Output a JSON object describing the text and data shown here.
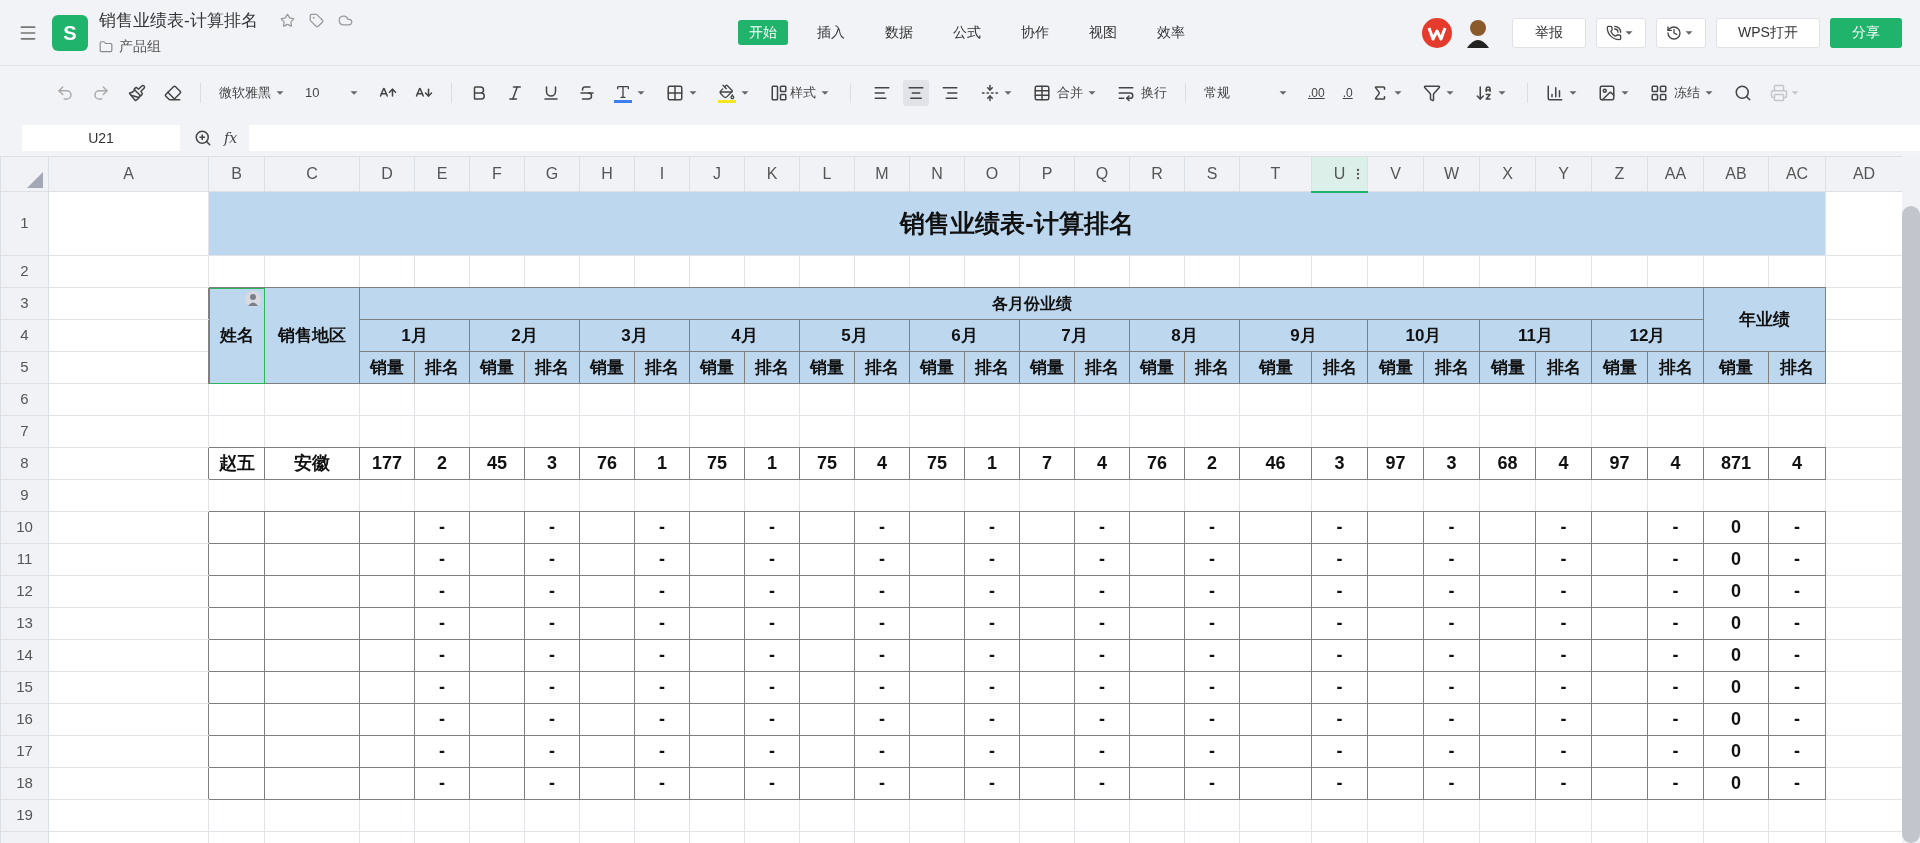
{
  "document": {
    "app_letter": "S",
    "title": "销售业绩表-计算排名",
    "folder": "产品组"
  },
  "menu_tabs": [
    {
      "label": "开始",
      "selected": true
    },
    {
      "label": "插入",
      "selected": false
    },
    {
      "label": "数据",
      "selected": false
    },
    {
      "label": "公式",
      "selected": false
    },
    {
      "label": "协作",
      "selected": false
    },
    {
      "label": "视图",
      "selected": false
    },
    {
      "label": "效率",
      "selected": false
    }
  ],
  "header_buttons": {
    "report": "举报",
    "open": "WPS打开",
    "share": "分享"
  },
  "toolbar": {
    "font": "微软雅黑",
    "size": "10",
    "style_label": "样式",
    "alignment": [
      {
        "kind": "left",
        "selected": false
      },
      {
        "kind": "center",
        "selected": true
      },
      {
        "kind": "right",
        "selected": false
      }
    ],
    "merge_label": "合并",
    "wrap_label": "换行",
    "number_format": "常规",
    "decimals": [
      ".00",
      ".0"
    ],
    "freeze_label": "冻结",
    "print": {
      "disabled": true
    }
  },
  "formula_bar": {
    "cell": "U21",
    "fx": "fx"
  },
  "columns": [
    {
      "label": "A",
      "selected": false
    },
    {
      "label": "B",
      "selected": false
    },
    {
      "label": "C",
      "selected": false
    },
    {
      "label": "D",
      "selected": false
    },
    {
      "label": "E",
      "selected": false
    },
    {
      "label": "F",
      "selected": false
    },
    {
      "label": "G",
      "selected": false
    },
    {
      "label": "H",
      "selected": false
    },
    {
      "label": "I",
      "selected": false
    },
    {
      "label": "J",
      "selected": false
    },
    {
      "label": "K",
      "selected": false
    },
    {
      "label": "L",
      "selected": false
    },
    {
      "label": "M",
      "selected": false
    },
    {
      "label": "N",
      "selected": false
    },
    {
      "label": "O",
      "selected": false
    },
    {
      "label": "P",
      "selected": false
    },
    {
      "label": "Q",
      "selected": false
    },
    {
      "label": "R",
      "selected": false
    },
    {
      "label": "S",
      "selected": false
    },
    {
      "label": "T",
      "selected": false
    },
    {
      "label": "U",
      "selected": true
    },
    {
      "label": "V",
      "selected": false
    },
    {
      "label": "W",
      "selected": false
    },
    {
      "label": "X",
      "selected": false
    },
    {
      "label": "Y",
      "selected": false
    },
    {
      "label": "Z",
      "selected": false
    },
    {
      "label": "AA",
      "selected": false
    },
    {
      "label": "AB",
      "selected": false
    },
    {
      "label": "AC",
      "selected": false
    },
    {
      "label": "AD",
      "selected": false
    }
  ],
  "row_numbers": [
    "1",
    "2",
    "3",
    "4",
    "5",
    "6",
    "7",
    "8",
    "9",
    "10",
    "11",
    "12",
    "13",
    "14",
    "15",
    "16",
    "17",
    "18",
    "19"
  ],
  "sheet": {
    "title": "销售业绩表-计算排名",
    "name_header": {
      "text": "姓名",
      "cursor": true
    },
    "region_header": "销售地区",
    "monthly_header": "各月份业绩",
    "annual_header": "年业绩",
    "months": [
      "1月",
      "2月",
      "3月",
      "4月",
      "5月",
      "6月",
      "7月",
      "8月",
      "9月",
      "10月",
      "11月",
      "12月"
    ],
    "sub_headers": [
      "销量",
      "排名",
      "销量",
      "排名",
      "销量",
      "排名",
      "销量",
      "排名",
      "销量",
      "排名",
      "销量",
      "排名",
      "销量",
      "排名",
      "销量",
      "排名",
      "销量",
      "排名",
      "销量",
      "排名",
      "销量",
      "排名",
      "销量",
      "排名",
      "销量",
      "排名"
    ],
    "body_rows": [
      {
        "bordered": false
      },
      {
        "bordered": false
      },
      {
        "bordered": true,
        "cells": [
          "赵五",
          "安徽",
          "177",
          "2",
          "45",
          "3",
          "76",
          "1",
          "75",
          "1",
          "75",
          "4",
          "75",
          "1",
          "7",
          "4",
          "76",
          "2",
          "46",
          "3",
          "97",
          "3",
          "68",
          "4",
          "97",
          "4",
          "871",
          "4"
        ]
      },
      {
        "bordered": false
      },
      {
        "bordered": true,
        "cells": [
          null,
          null,
          null,
          "-",
          null,
          "-",
          null,
          "-",
          null,
          "-",
          null,
          "-",
          null,
          "-",
          null,
          "-",
          null,
          "-",
          null,
          "-",
          null,
          "-",
          null,
          "-",
          null,
          "-",
          "0",
          "-"
        ]
      },
      {
        "bordered": true,
        "cells": [
          null,
          null,
          null,
          "-",
          null,
          "-",
          null,
          "-",
          null,
          "-",
          null,
          "-",
          null,
          "-",
          null,
          "-",
          null,
          "-",
          null,
          "-",
          null,
          "-",
          null,
          "-",
          null,
          "-",
          "0",
          "-"
        ]
      },
      {
        "bordered": true,
        "cells": [
          null,
          null,
          null,
          "-",
          null,
          "-",
          null,
          "-",
          null,
          "-",
          null,
          "-",
          null,
          "-",
          null,
          "-",
          null,
          "-",
          null,
          "-",
          null,
          "-",
          null,
          "-",
          null,
          "-",
          "0",
          "-"
        ]
      },
      {
        "bordered": true,
        "cells": [
          null,
          null,
          null,
          "-",
          null,
          "-",
          null,
          "-",
          null,
          "-",
          null,
          "-",
          null,
          "-",
          null,
          "-",
          null,
          "-",
          null,
          "-",
          null,
          "-",
          null,
          "-",
          null,
          "-",
          "0",
          "-"
        ]
      },
      {
        "bordered": true,
        "cells": [
          null,
          null,
          null,
          "-",
          null,
          "-",
          null,
          "-",
          null,
          "-",
          null,
          "-",
          null,
          "-",
          null,
          "-",
          null,
          "-",
          null,
          "-",
          null,
          "-",
          null,
          "-",
          null,
          "-",
          "0",
          "-"
        ]
      },
      {
        "bordered": true,
        "cells": [
          null,
          null,
          null,
          "-",
          null,
          "-",
          null,
          "-",
          null,
          "-",
          null,
          "-",
          null,
          "-",
          null,
          "-",
          null,
          "-",
          null,
          "-",
          null,
          "-",
          null,
          "-",
          null,
          "-",
          "0",
          "-"
        ]
      },
      {
        "bordered": true,
        "cells": [
          null,
          null,
          null,
          "-",
          null,
          "-",
          null,
          "-",
          null,
          "-",
          null,
          "-",
          null,
          "-",
          null,
          "-",
          null,
          "-",
          null,
          "-",
          null,
          "-",
          null,
          "-",
          null,
          "-",
          "0",
          "-"
        ]
      },
      {
        "bordered": true,
        "cells": [
          null,
          null,
          null,
          "-",
          null,
          "-",
          null,
          "-",
          null,
          "-",
          null,
          "-",
          null,
          "-",
          null,
          "-",
          null,
          "-",
          null,
          "-",
          null,
          "-",
          null,
          "-",
          null,
          "-",
          "0",
          "-"
        ]
      },
      {
        "bordered": true,
        "cells": [
          null,
          null,
          null,
          "-",
          null,
          "-",
          null,
          "-",
          null,
          "-",
          null,
          "-",
          null,
          "-",
          null,
          "-",
          null,
          "-",
          null,
          "-",
          null,
          "-",
          null,
          "-",
          null,
          "-",
          "0",
          "-"
        ]
      },
      {
        "bordered": false
      }
    ]
  }
}
